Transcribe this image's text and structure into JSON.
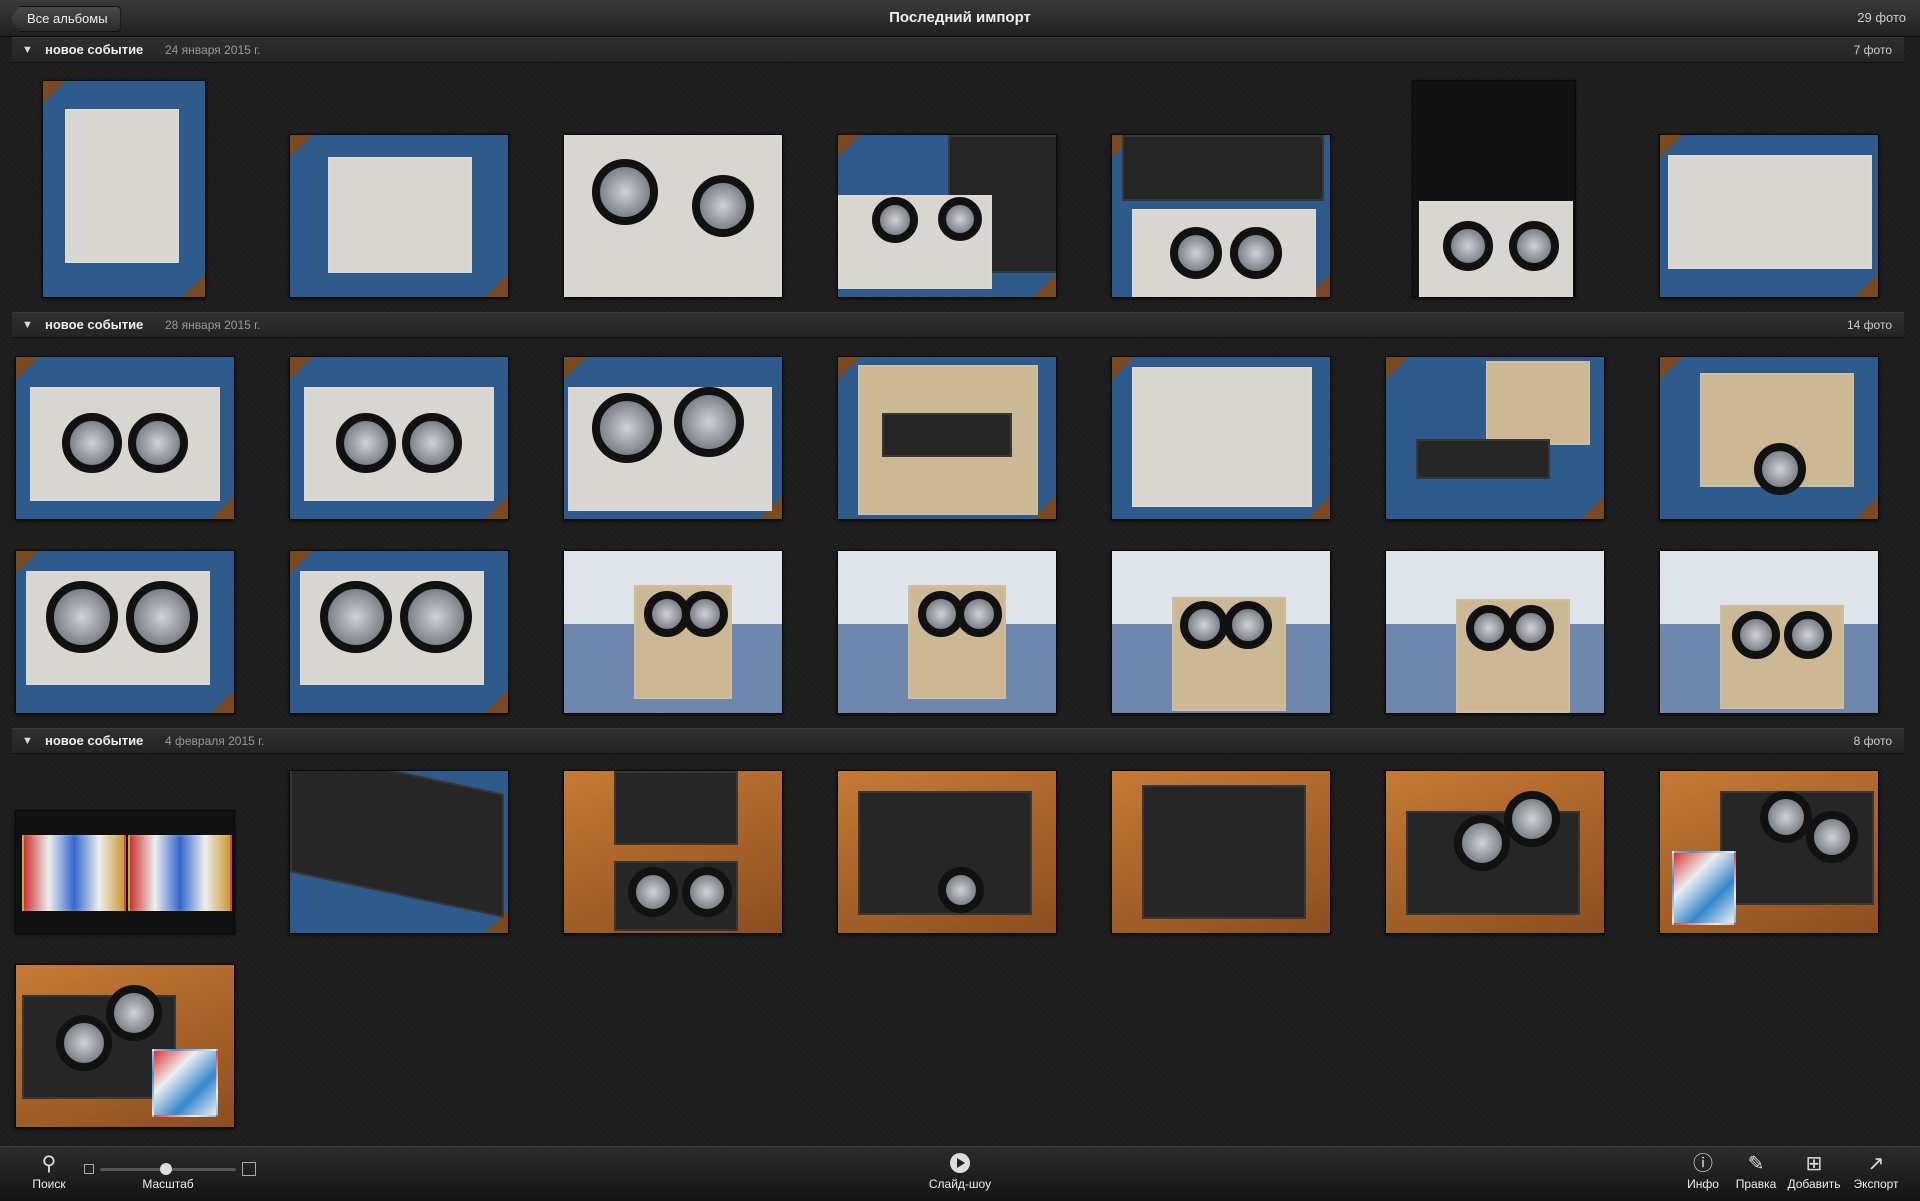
{
  "topbar": {
    "back_label": "Все альбомы",
    "title": "Последний импорт",
    "count": "29 фото"
  },
  "events": [
    {
      "title": "новое событие",
      "date": "24 января 2015 г.",
      "count": "7 фото"
    },
    {
      "title": "новое событие",
      "date": "28 января 2015 г.",
      "count": "14 фото"
    },
    {
      "title": "новое событие",
      "date": "4 февраля 2015 г.",
      "count": "8 фото"
    }
  ],
  "toolbar": {
    "search_label": "Поиск",
    "zoom_label": "Масштаб",
    "slideshow_label": "Слайд-шоу",
    "info_label": "Инфо",
    "edit_label": "Правка",
    "add_label": "Добавить",
    "export_label": "Экспорт"
  },
  "icons": {
    "search": "search-icon",
    "slideshow": "play-icon",
    "info": "info-icon",
    "edit": "pencil-icon",
    "add": "plus-icon",
    "export": "share-icon"
  }
}
